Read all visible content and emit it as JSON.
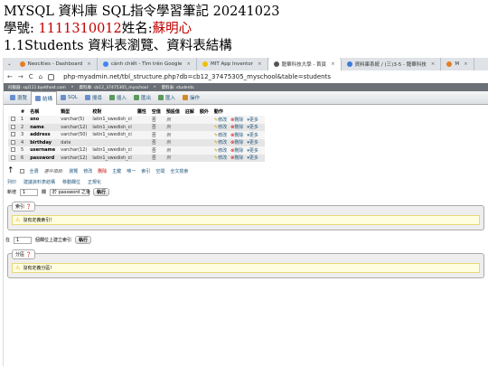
{
  "doc": {
    "title": "MYSQL 資料庫 SQL指令學習筆記 20241023",
    "student_label": "學號: ",
    "student_id": "1111310012",
    "name_label": "姓名:",
    "student_name": "蘇明心",
    "section": "1.1Students 資料表瀏覽、資料表結構"
  },
  "browser": {
    "tabs": [
      {
        "label": "Neocities - Dashboard",
        "color": "#e67e22"
      },
      {
        "label": "cành chiết - Tìm trên Google",
        "color": "#4285f4"
      },
      {
        "label": "MIT App Inventor",
        "color": "#f0c000"
      },
      {
        "label": "龍華科技大學 - 首頁",
        "color": "#555555"
      },
      {
        "label": "資料庫系統 / (三)3-5 - 龍華科技",
        "color": "#3a7bd5"
      },
      {
        "label": "M",
        "color": "#e67e22"
      }
    ],
    "url": "php-myadmin.net/tbl_structure.php?db=cb12_37475305_myschool&table=students",
    "breadcrumb": [
      "伺服器: sql111.byethost.com",
      "資料庫: cb12_37475305_myschool",
      "資料表: students"
    ]
  },
  "pma": {
    "tabs": [
      "瀏覽",
      "結構",
      "SQL",
      "搜尋",
      "插入",
      "匯出",
      "匯入",
      "操作"
    ],
    "tab_colors": [
      "#6a8fd0",
      "#6a8fd0",
      "#6a8fd0",
      "#6a8fd0",
      "#5a9a5a",
      "#5a9a5a",
      "#5a9a5a",
      "#d08a2a"
    ],
    "columns_header": [
      "#",
      "名稱",
      "類型",
      "校對",
      "屬性",
      "空值",
      "預設值",
      "註解",
      "額外",
      "動作"
    ],
    "rows": [
      {
        "n": "1",
        "name": "sno",
        "type": "varchar(5)",
        "collation": "latin1_swedish_ci",
        "null": "否",
        "default": "無"
      },
      {
        "n": "2",
        "name": "name",
        "type": "varchar(12)",
        "collation": "latin1_swedish_ci",
        "null": "否",
        "default": "無"
      },
      {
        "n": "3",
        "name": "address",
        "type": "varchar(50)",
        "collation": "latin1_swedish_ci",
        "null": "否",
        "default": "無"
      },
      {
        "n": "4",
        "name": "birthday",
        "type": "date",
        "collation": "",
        "null": "否",
        "default": "無"
      },
      {
        "n": "5",
        "name": "username",
        "type": "varchar(12)",
        "collation": "latin1_swedish_ci",
        "null": "否",
        "default": "無"
      },
      {
        "n": "6",
        "name": "password",
        "type": "varchar(12)",
        "collation": "latin1_swedish_ci",
        "null": "否",
        "default": "無"
      }
    ],
    "row_actions": {
      "edit": "修改",
      "delete": "刪除",
      "more": "更多"
    },
    "bulk": {
      "check_all": "全選",
      "with_selected": "選中項目:",
      "browse": "瀏覽",
      "edit": "修改",
      "delete": "刪除",
      "primary": "主鍵",
      "unique": "唯一",
      "index": "索引",
      "spatial": "空間",
      "fulltext": "全文檢索"
    },
    "links": {
      "print": "列印",
      "propose": "建議資料表結構",
      "move_columns": "移動欄位",
      "normalize": "正規化"
    },
    "add": {
      "label": "新增",
      "count": "1",
      "unit": "欄",
      "position": "於 password 之後",
      "go": "執行"
    },
    "indexes": {
      "legend": "索引",
      "notice": "沒有定義索引!",
      "create_prefix": "在",
      "create_count": "1",
      "create_suffix": "個欄位上建立索引",
      "go": "執行"
    },
    "partitions": {
      "legend": "分區",
      "notice": "沒有定義分區!"
    }
  }
}
